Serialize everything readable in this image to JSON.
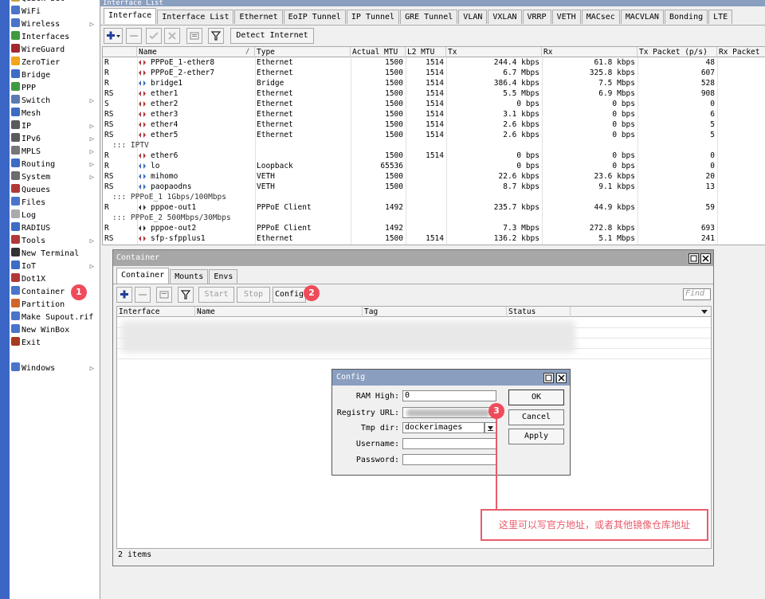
{
  "window": {
    "title": "Interface List"
  },
  "sidebar": {
    "items": [
      {
        "label": "Quick Set",
        "icon": "quickset-icon",
        "color": "#c8a040"
      },
      {
        "label": "WiFi",
        "icon": "wifi-icon",
        "color": "#4a74c9"
      },
      {
        "label": "Wireless",
        "icon": "wireless-icon",
        "color": "#4a74c9"
      },
      {
        "label": "Interfaces",
        "icon": "interfaces-icon",
        "color": "#3f9a3f"
      },
      {
        "label": "WireGuard",
        "icon": "wireguard-icon",
        "color": "#a3292e"
      },
      {
        "label": "ZeroTier",
        "icon": "zerotier-icon",
        "color": "#f2a51b"
      },
      {
        "label": "Bridge",
        "icon": "bridge-icon",
        "color": "#3c6cc4"
      },
      {
        "label": "PPP",
        "icon": "ppp-icon",
        "color": "#3f9a3f"
      },
      {
        "label": "Switch",
        "icon": "switch-icon",
        "color": "#5a7ab3"
      },
      {
        "label": "Mesh",
        "icon": "mesh-icon",
        "color": "#3c6cc4"
      },
      {
        "label": "IP",
        "icon": "ip-icon",
        "color": "#5b5b5b"
      },
      {
        "label": "IPv6",
        "icon": "ipv6-icon",
        "color": "#5b5b5b"
      },
      {
        "label": "MPLS",
        "icon": "mpls-icon",
        "color": "#777777"
      },
      {
        "label": "Routing",
        "icon": "routing-icon",
        "color": "#3c6cc4"
      },
      {
        "label": "System",
        "icon": "system-icon",
        "color": "#6c6c6c"
      },
      {
        "label": "Queues",
        "icon": "queues-icon",
        "color": "#b23838"
      },
      {
        "label": "Files",
        "icon": "files-icon",
        "color": "#4a74c9"
      },
      {
        "label": "Log",
        "icon": "log-icon",
        "color": "#aaaaaa"
      },
      {
        "label": "RADIUS",
        "icon": "radius-icon",
        "color": "#3c6cc4"
      },
      {
        "label": "Tools",
        "icon": "tools-icon",
        "color": "#b23838"
      },
      {
        "label": "New Terminal",
        "icon": "terminal-icon",
        "color": "#333333"
      },
      {
        "label": "IoT",
        "icon": "iot-icon",
        "color": "#3c6cc4"
      },
      {
        "label": "Dot1X",
        "icon": "dot1x-icon",
        "color": "#b23838"
      },
      {
        "label": "Container",
        "icon": "container-icon",
        "color": "#4a74c9"
      },
      {
        "label": "Partition",
        "icon": "partition-icon",
        "color": "#d0662e"
      },
      {
        "label": "Make Supout.rif",
        "icon": "supout-icon",
        "color": "#4a74c9"
      },
      {
        "label": "New WinBox",
        "icon": "winbox-icon",
        "color": "#4a74c9"
      },
      {
        "label": "Exit",
        "icon": "exit-icon",
        "color": "#a83a1e"
      },
      {
        "label": "Windows",
        "icon": "windows-icon",
        "color": "#4a74c9"
      }
    ]
  },
  "tabs": [
    "Interface",
    "Interface List",
    "Ethernet",
    "EoIP Tunnel",
    "IP Tunnel",
    "GRE Tunnel",
    "VLAN",
    "VXLAN",
    "VRRP",
    "VETH",
    "MACsec",
    "MACVLAN",
    "Bonding",
    "LTE"
  ],
  "toolbar": {
    "detect_label": "Detect Internet"
  },
  "grid": {
    "columns": [
      "Name",
      "Type",
      "Actual MTU",
      "L2 MTU",
      "Tx",
      "Rx",
      "Tx Packet (p/s)",
      "Rx Packet"
    ],
    "rows": [
      {
        "kind": "row",
        "flag": "R",
        "name": "PPPoE_1-ether8",
        "type": "Ethernet",
        "mtu": "1500",
        "l2": "1514",
        "tx": "244.4 kbps",
        "rx": "61.8 kbps",
        "txp": "48"
      },
      {
        "kind": "row",
        "flag": "R",
        "name": "PPPoE_2-ether7",
        "type": "Ethernet",
        "mtu": "1500",
        "l2": "1514",
        "tx": "6.7 Mbps",
        "rx": "325.8 kbps",
        "txp": "607"
      },
      {
        "kind": "row",
        "flag": "R",
        "name": "bridge1",
        "type": "Bridge",
        "mtu": "1500",
        "l2": "1514",
        "tx": "386.4 kbps",
        "rx": "7.5 Mbps",
        "txp": "528"
      },
      {
        "kind": "row",
        "flag": "RS",
        "name": "ether1",
        "type": "Ethernet",
        "mtu": "1500",
        "l2": "1514",
        "tx": "5.5 Mbps",
        "rx": "6.9 Mbps",
        "txp": "908"
      },
      {
        "kind": "row",
        "flag": "S",
        "name": "ether2",
        "type": "Ethernet",
        "mtu": "1500",
        "l2": "1514",
        "tx": "0 bps",
        "rx": "0 bps",
        "txp": "0"
      },
      {
        "kind": "row",
        "flag": "RS",
        "name": "ether3",
        "type": "Ethernet",
        "mtu": "1500",
        "l2": "1514",
        "tx": "3.1 kbps",
        "rx": "0 bps",
        "txp": "6"
      },
      {
        "kind": "row",
        "flag": "RS",
        "name": "ether4",
        "type": "Ethernet",
        "mtu": "1500",
        "l2": "1514",
        "tx": "2.6 kbps",
        "rx": "0 bps",
        "txp": "5"
      },
      {
        "kind": "row",
        "flag": "RS",
        "name": "ether5",
        "type": "Ethernet",
        "mtu": "1500",
        "l2": "1514",
        "tx": "2.6 kbps",
        "rx": "0 bps",
        "txp": "5"
      },
      {
        "kind": "sep",
        "label": "::: IPTV"
      },
      {
        "kind": "row",
        "flag": "R",
        "name": "ether6",
        "type": "",
        "mtu": "1500",
        "l2": "1514",
        "tx": "0 bps",
        "rx": "0 bps",
        "txp": "0"
      },
      {
        "kind": "row",
        "flag": "R",
        "name": "lo",
        "type": "Loopback",
        "mtu": "65536",
        "l2": "",
        "tx": "0 bps",
        "rx": "0 bps",
        "txp": "0"
      },
      {
        "kind": "row",
        "flag": "RS",
        "name": "mihomo",
        "type": "VETH",
        "mtu": "1500",
        "l2": "",
        "tx": "22.6 kbps",
        "rx": "23.6 kbps",
        "txp": "20"
      },
      {
        "kind": "row",
        "flag": "RS",
        "name": "paopaodns",
        "type": "VETH",
        "mtu": "1500",
        "l2": "",
        "tx": "8.7 kbps",
        "rx": "9.1 kbps",
        "txp": "13"
      },
      {
        "kind": "sep",
        "label": "::: PPPoE_1 1Gbps/100Mbps"
      },
      {
        "kind": "row",
        "flag": "R",
        "name": "pppoe-out1",
        "type": "PPPoE Client",
        "mtu": "1492",
        "l2": "",
        "tx": "235.7 kbps",
        "rx": "44.9 kbps",
        "txp": "59"
      },
      {
        "kind": "sep",
        "label": "::: PPPoE_2 500Mbps/30Mbps"
      },
      {
        "kind": "row",
        "flag": "R",
        "name": "pppoe-out2",
        "type": "PPPoE Client",
        "mtu": "1492",
        "l2": "",
        "tx": "7.3 Mbps",
        "rx": "272.8 kbps",
        "txp": "693"
      },
      {
        "kind": "row",
        "flag": "RS",
        "name": "sfp-sfpplus1",
        "type": "Ethernet",
        "mtu": "1500",
        "l2": "1514",
        "tx": "136.2 kbps",
        "rx": "5.1 Mbps",
        "txp": "241"
      }
    ]
  },
  "container": {
    "title": "Container",
    "tabs": [
      "Container",
      "Mounts",
      "Envs"
    ],
    "start_label": "Start",
    "stop_label": "Stop",
    "config_label": "Config",
    "find_placeholder": "Find",
    "columns": [
      "Interface",
      "Name",
      "Tag",
      "Status"
    ],
    "count": "2 items"
  },
  "config": {
    "title": "Config",
    "labels": {
      "ram": "RAM High:",
      "registry": "Registry URL:",
      "tmp": "Tmp dir:",
      "user": "Username:",
      "pass": "Password:"
    },
    "values": {
      "ram": "0",
      "tmp": "dockerimages"
    },
    "ok_label": "OK",
    "cancel_label": "Cancel",
    "apply_label": "Apply"
  },
  "annotations": {
    "badge1": "1",
    "badge2": "2",
    "badge3": "3",
    "note": "这里可以写官方地址，或者其他镜像仓库地址"
  }
}
